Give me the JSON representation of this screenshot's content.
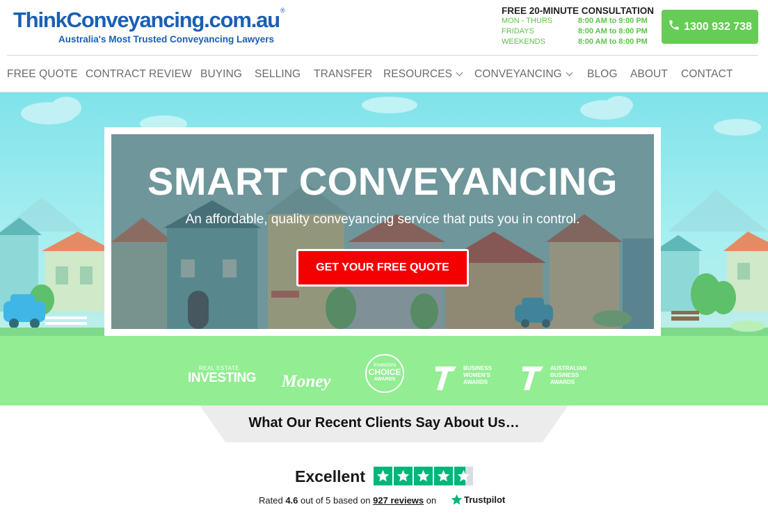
{
  "header": {
    "logo_text": "ThinkConveyancing.com.au",
    "logo_reg": "®",
    "tagline": "Australia's Most Trusted Conveyancing Lawyers",
    "hours_title": "FREE 20-MINUTE CONSULTATION",
    "hours": [
      {
        "day": "MON - THURS",
        "time": "8:00 AM to 9:00 PM"
      },
      {
        "day": "FRIDAYS",
        "time": "8:00 AM to 8:00 PM"
      },
      {
        "day": "WEEKENDS",
        "time": "8:00 AM to 8:00 PM"
      }
    ],
    "phone": "1300 932 738"
  },
  "nav": {
    "items": [
      {
        "label": "FREE QUOTE"
      },
      {
        "label": "CONTRACT REVIEW"
      },
      {
        "label": "BUYING"
      },
      {
        "label": "SELLING"
      },
      {
        "label": "TRANSFER"
      },
      {
        "label": "RESOURCES",
        "dropdown": true
      },
      {
        "label": "CONVEYANCING",
        "dropdown": true
      },
      {
        "label": "BLOG"
      },
      {
        "label": "ABOUT"
      },
      {
        "label": "CONTACT"
      }
    ]
  },
  "hero": {
    "title": "SMART CONVEYANCING",
    "subtitle": "An affordable, quality conveyancing service that puts you in control.",
    "cta": "GET YOUR FREE QUOTE"
  },
  "awards": {
    "items": [
      {
        "line1": "REAL ESTATE",
        "line2": "INVESTING"
      },
      {
        "line1": "Money"
      },
      {
        "line1": "Investors",
        "line2": "CHOICE",
        "line3": "AWARDS"
      },
      {
        "line1": "BUSINESS",
        "line2": "WOMEN'S",
        "line3": "AWARDS"
      },
      {
        "line1": "AUSTRALIAN",
        "line2": "BUSINESS",
        "line3": "AWARDS"
      }
    ]
  },
  "reviews": {
    "heading": "What Our Recent Clients Say About Us…",
    "rating_word": "Excellent",
    "rated_prefix": "Rated",
    "score": "4.6",
    "out_of": "out of 5 based on",
    "review_count": "927 reviews",
    "on": "on",
    "brand": "Trustpilot",
    "stars": 4.6
  },
  "colors": {
    "brand_blue": "#1a5fb4",
    "accent_green": "#66cc55",
    "cta_red": "#f40000",
    "awards_bg": "#93ed93",
    "trustpilot_green": "#00b67a"
  }
}
